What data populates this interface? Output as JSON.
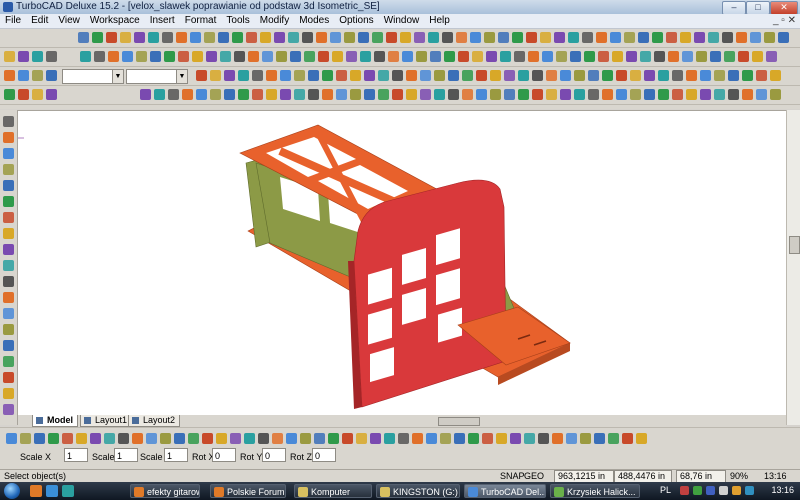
{
  "window": {
    "title": "TurboCAD Deluxe 15.2 - [velox_slawek poprawianie od podstaw 3d Isometric_SE]",
    "minimize": "–",
    "maximize": "□",
    "close": "✕"
  },
  "menu": {
    "items": [
      "File",
      "Edit",
      "View",
      "Workspace",
      "Insert",
      "Format",
      "Tools",
      "Modify",
      "Modes",
      "Options",
      "Window",
      "Help"
    ],
    "right_controls": "_ ▫ ✕"
  },
  "toolbar_icons": [
    "snap-icon",
    "new-file-icon",
    "open-file-icon",
    "save-icon",
    "print-icon",
    "cut-icon",
    "copy-icon",
    "paste-icon",
    "undo-icon",
    "redo-icon",
    "zoom-icon",
    "render-icon",
    "box-icon",
    "cylinder-icon",
    "sphere-icon",
    "extrude-icon",
    "measure-icon",
    "layer-icon"
  ],
  "tabs": [
    {
      "label": "Model",
      "active": true
    },
    {
      "label": "Layout1",
      "active": false
    },
    {
      "label": "Layout2",
      "active": false
    }
  ],
  "inspector": {
    "fields": [
      {
        "label": "Scale X",
        "value": "1"
      },
      {
        "label": "Scale Y",
        "value": "1"
      },
      {
        "label": "Scale Z",
        "value": "1"
      },
      {
        "label": "Rot X",
        "value": "0"
      },
      {
        "label": "Rot Y",
        "value": "0"
      },
      {
        "label": "Rot Z",
        "value": "0"
      }
    ]
  },
  "status": {
    "message": "Select object(s)",
    "snap": "SNAP",
    "geo": "GEO",
    "x": "963,1215 in",
    "y": "488,4476 in",
    "z": "68,76 in",
    "zoom": "90%",
    "time": "13:16"
  },
  "taskbar": {
    "items": [
      {
        "label": "efekty gitarow...",
        "active": false
      },
      {
        "label": "Polskie Forum ...",
        "active": false
      },
      {
        "label": "Komputer",
        "active": false
      },
      {
        "label": "KINGSTON (G:)",
        "active": false
      },
      {
        "label": "TurboCAD Del...",
        "active": true
      },
      {
        "label": "Krzysiek Halick...",
        "active": false
      }
    ],
    "language": "PL",
    "clock": "13:16"
  },
  "colors": {
    "frame_orange": "#e8612c",
    "frame_green": "#8c9a46",
    "frame_red": "#d9393b",
    "title_bar": "#b9cce3"
  }
}
